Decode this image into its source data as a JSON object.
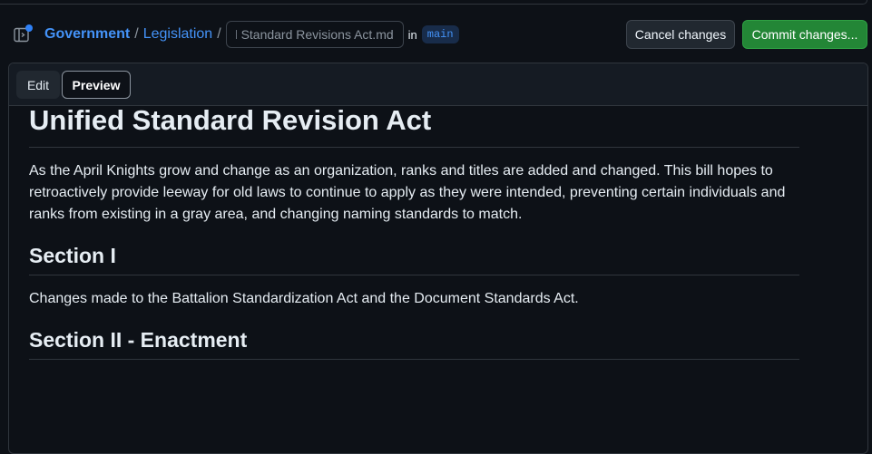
{
  "header": {
    "breadcrumb": {
      "repo": "Government",
      "folder": "Legislation",
      "separator": "/"
    },
    "filename_value": "Unified Standard Revisions Act.md",
    "in_label": "in",
    "branch": "main",
    "cancel_label": "Cancel changes",
    "commit_label": "Commit changes..."
  },
  "editor": {
    "tabs": [
      {
        "label": "Edit",
        "active": false
      },
      {
        "label": "Preview",
        "active": true
      }
    ]
  },
  "document": {
    "title": "Unified Standard Revision Act",
    "intro": "As the April Knights grow and change as an organization, ranks and titles are added and changed. This bill hopes to retroactively provide leeway for old laws to continue to apply as they were intended, preventing certain individuals and ranks from existing in a gray area, and changing naming standards to match.",
    "section1_heading": "Section I",
    "section1_text": "Changes made to the Battalion Standardization Act and the Document Standards Act.",
    "section2_heading": "Section II - Enactment"
  },
  "icons": {
    "sidebar_toggle": "sidebar-expand-icon"
  },
  "colors": {
    "background": "#0d1117",
    "link": "#4493f8",
    "commit_button": "#238636",
    "branch_badge_bg": "#182c4a",
    "notification_dot": "#2f81f7"
  }
}
